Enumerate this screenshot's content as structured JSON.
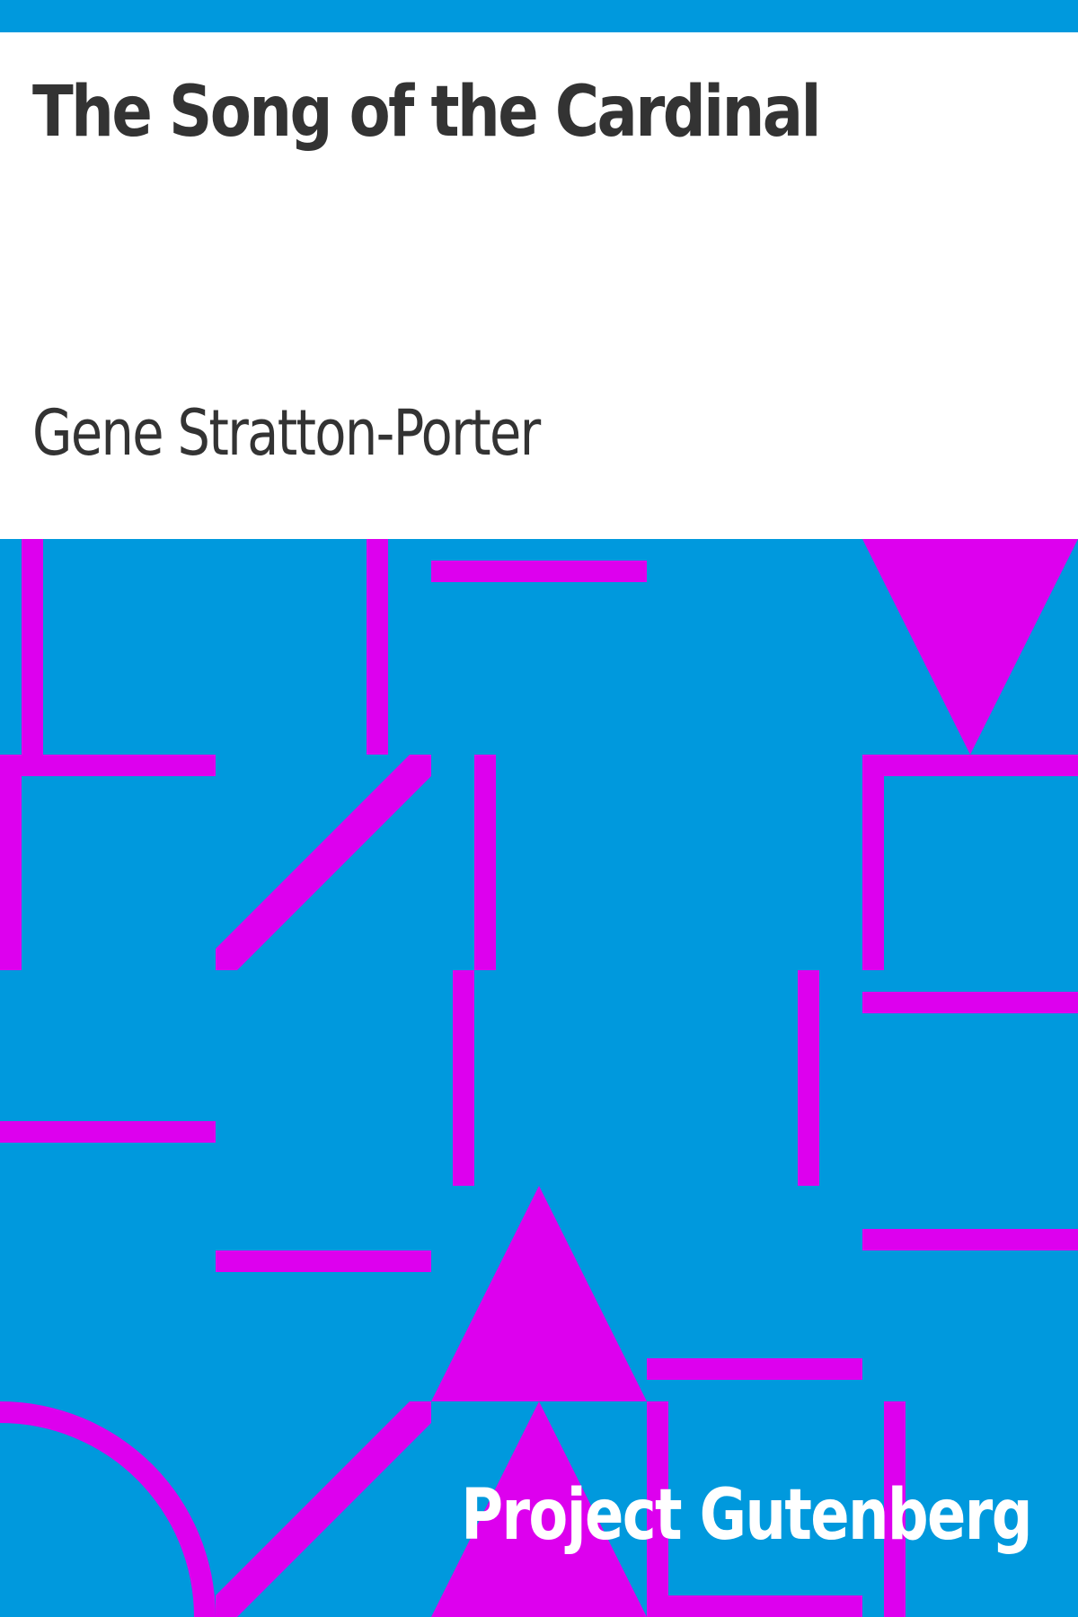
{
  "cover": {
    "title": "The Song of the Cardinal",
    "author": "Gene Stratton-Porter",
    "publisher": "Project Gutenberg"
  },
  "colors": {
    "background_blue": "#0099dd",
    "pattern_magenta": "#dd00ee",
    "text_dark": "#333333",
    "text_light": "#ffffff"
  }
}
